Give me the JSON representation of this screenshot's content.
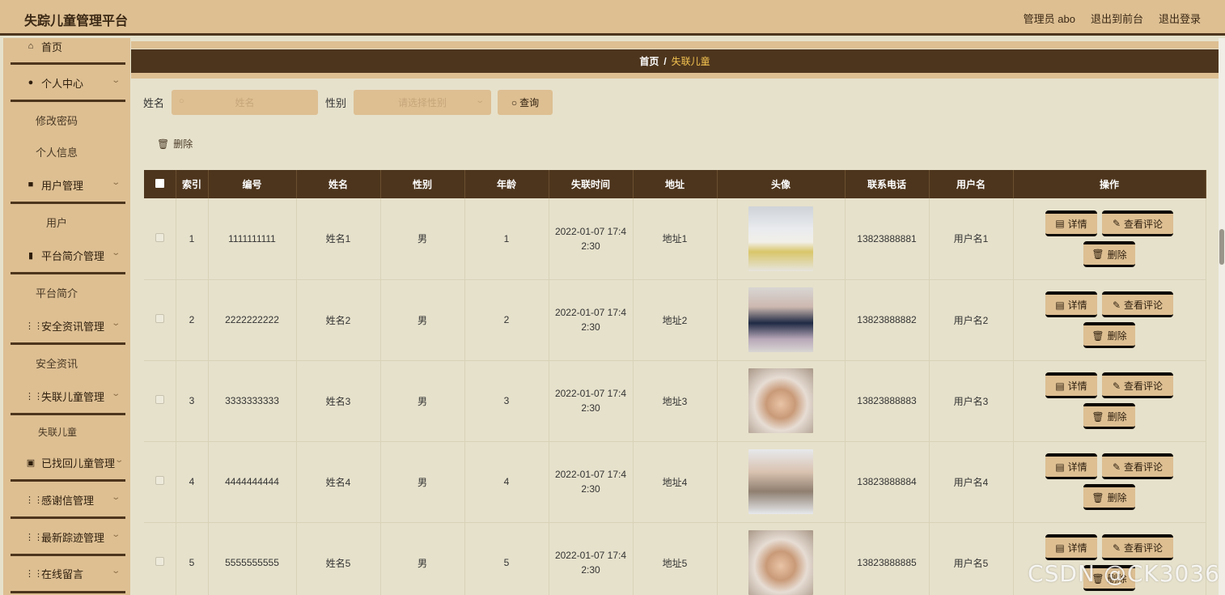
{
  "app": {
    "title": "失踪儿童管理平台"
  },
  "header": {
    "links": [
      "管理员 abo",
      "退出到前台",
      "退出登录"
    ]
  },
  "sidebar": {
    "items": [
      {
        "label": "首页",
        "icon": "home-icon",
        "glyph": "⌂",
        "top": 0
      },
      {
        "label": "个人中心",
        "icon": "user-icon",
        "glyph": "●"
      },
      {
        "label": "用户管理",
        "icon": "briefcase-icon",
        "glyph": "■"
      },
      {
        "label": "平台简介管理",
        "icon": "book-icon",
        "glyph": "▮"
      },
      {
        "label": "安全资讯管理",
        "icon": "grid-icon",
        "glyph": "⋮⋮"
      },
      {
        "label": "失联儿童管理",
        "icon": "grid-icon",
        "glyph": "⋮⋮"
      },
      {
        "label": "已找回儿童管理",
        "icon": "clipboard-icon",
        "glyph": "▣"
      },
      {
        "label": "感谢信管理",
        "icon": "grid-icon",
        "glyph": "⋮⋮"
      },
      {
        "label": "最新踪迹管理",
        "icon": "grid-icon",
        "glyph": "⋮⋮"
      },
      {
        "label": "在线留言",
        "icon": "grid-icon",
        "glyph": "⋮⋮"
      }
    ],
    "subs": [
      "修改密码",
      "个人信息",
      "用户",
      "平台简介",
      "安全资讯",
      "失联儿童"
    ]
  },
  "breadcrumb": {
    "home": "首页",
    "sep": "/",
    "current": "失联儿童"
  },
  "search": {
    "name_label": "姓名",
    "name_placeholder": "姓名",
    "gender_label": "性别",
    "gender_placeholder": "请选择性别",
    "query_button": "查询"
  },
  "toolbar": {
    "delete_label": "删除"
  },
  "table": {
    "columns": [
      "索引",
      "编号",
      "姓名",
      "性别",
      "年龄",
      "失联时间",
      "地址",
      "头像",
      "联系电话",
      "用户名",
      "操作"
    ],
    "rows": [
      {
        "index": "1",
        "code": "1111111111",
        "name": "姓名1",
        "gender": "男",
        "age": "1",
        "time1": "2022-01-07 17:4",
        "time2": "2:30",
        "address": "地址1",
        "phone": "13823888881",
        "username": "用户名1"
      },
      {
        "index": "2",
        "code": "2222222222",
        "name": "姓名2",
        "gender": "男",
        "age": "2",
        "time1": "2022-01-07 17:4",
        "time2": "2:30",
        "address": "地址2",
        "phone": "13823888882",
        "username": "用户名2"
      },
      {
        "index": "3",
        "code": "3333333333",
        "name": "姓名3",
        "gender": "男",
        "age": "3",
        "time1": "2022-01-07 17:4",
        "time2": "2:30",
        "address": "地址3",
        "phone": "13823888883",
        "username": "用户名3"
      },
      {
        "index": "4",
        "code": "4444444444",
        "name": "姓名4",
        "gender": "男",
        "age": "4",
        "time1": "2022-01-07 17:4",
        "time2": "2:30",
        "address": "地址4",
        "phone": "13823888884",
        "username": "用户名4"
      },
      {
        "index": "5",
        "code": "5555555555",
        "name": "姓名5",
        "gender": "男",
        "age": "5",
        "time1": "2022-01-07 17:4",
        "time2": "2:30",
        "address": "地址5",
        "phone": "13823888885",
        "username": "用户名5"
      }
    ],
    "actions": {
      "detail": "详情",
      "comments": "查看评论",
      "delete": "删除"
    }
  },
  "watermark": "CSDN @CK3036",
  "colors": {
    "header_bg": "#ddbf92",
    "accent_dark": "#4d351d",
    "content_bg": "#e6e1cb",
    "breadcrumb_current": "#f3c250"
  }
}
